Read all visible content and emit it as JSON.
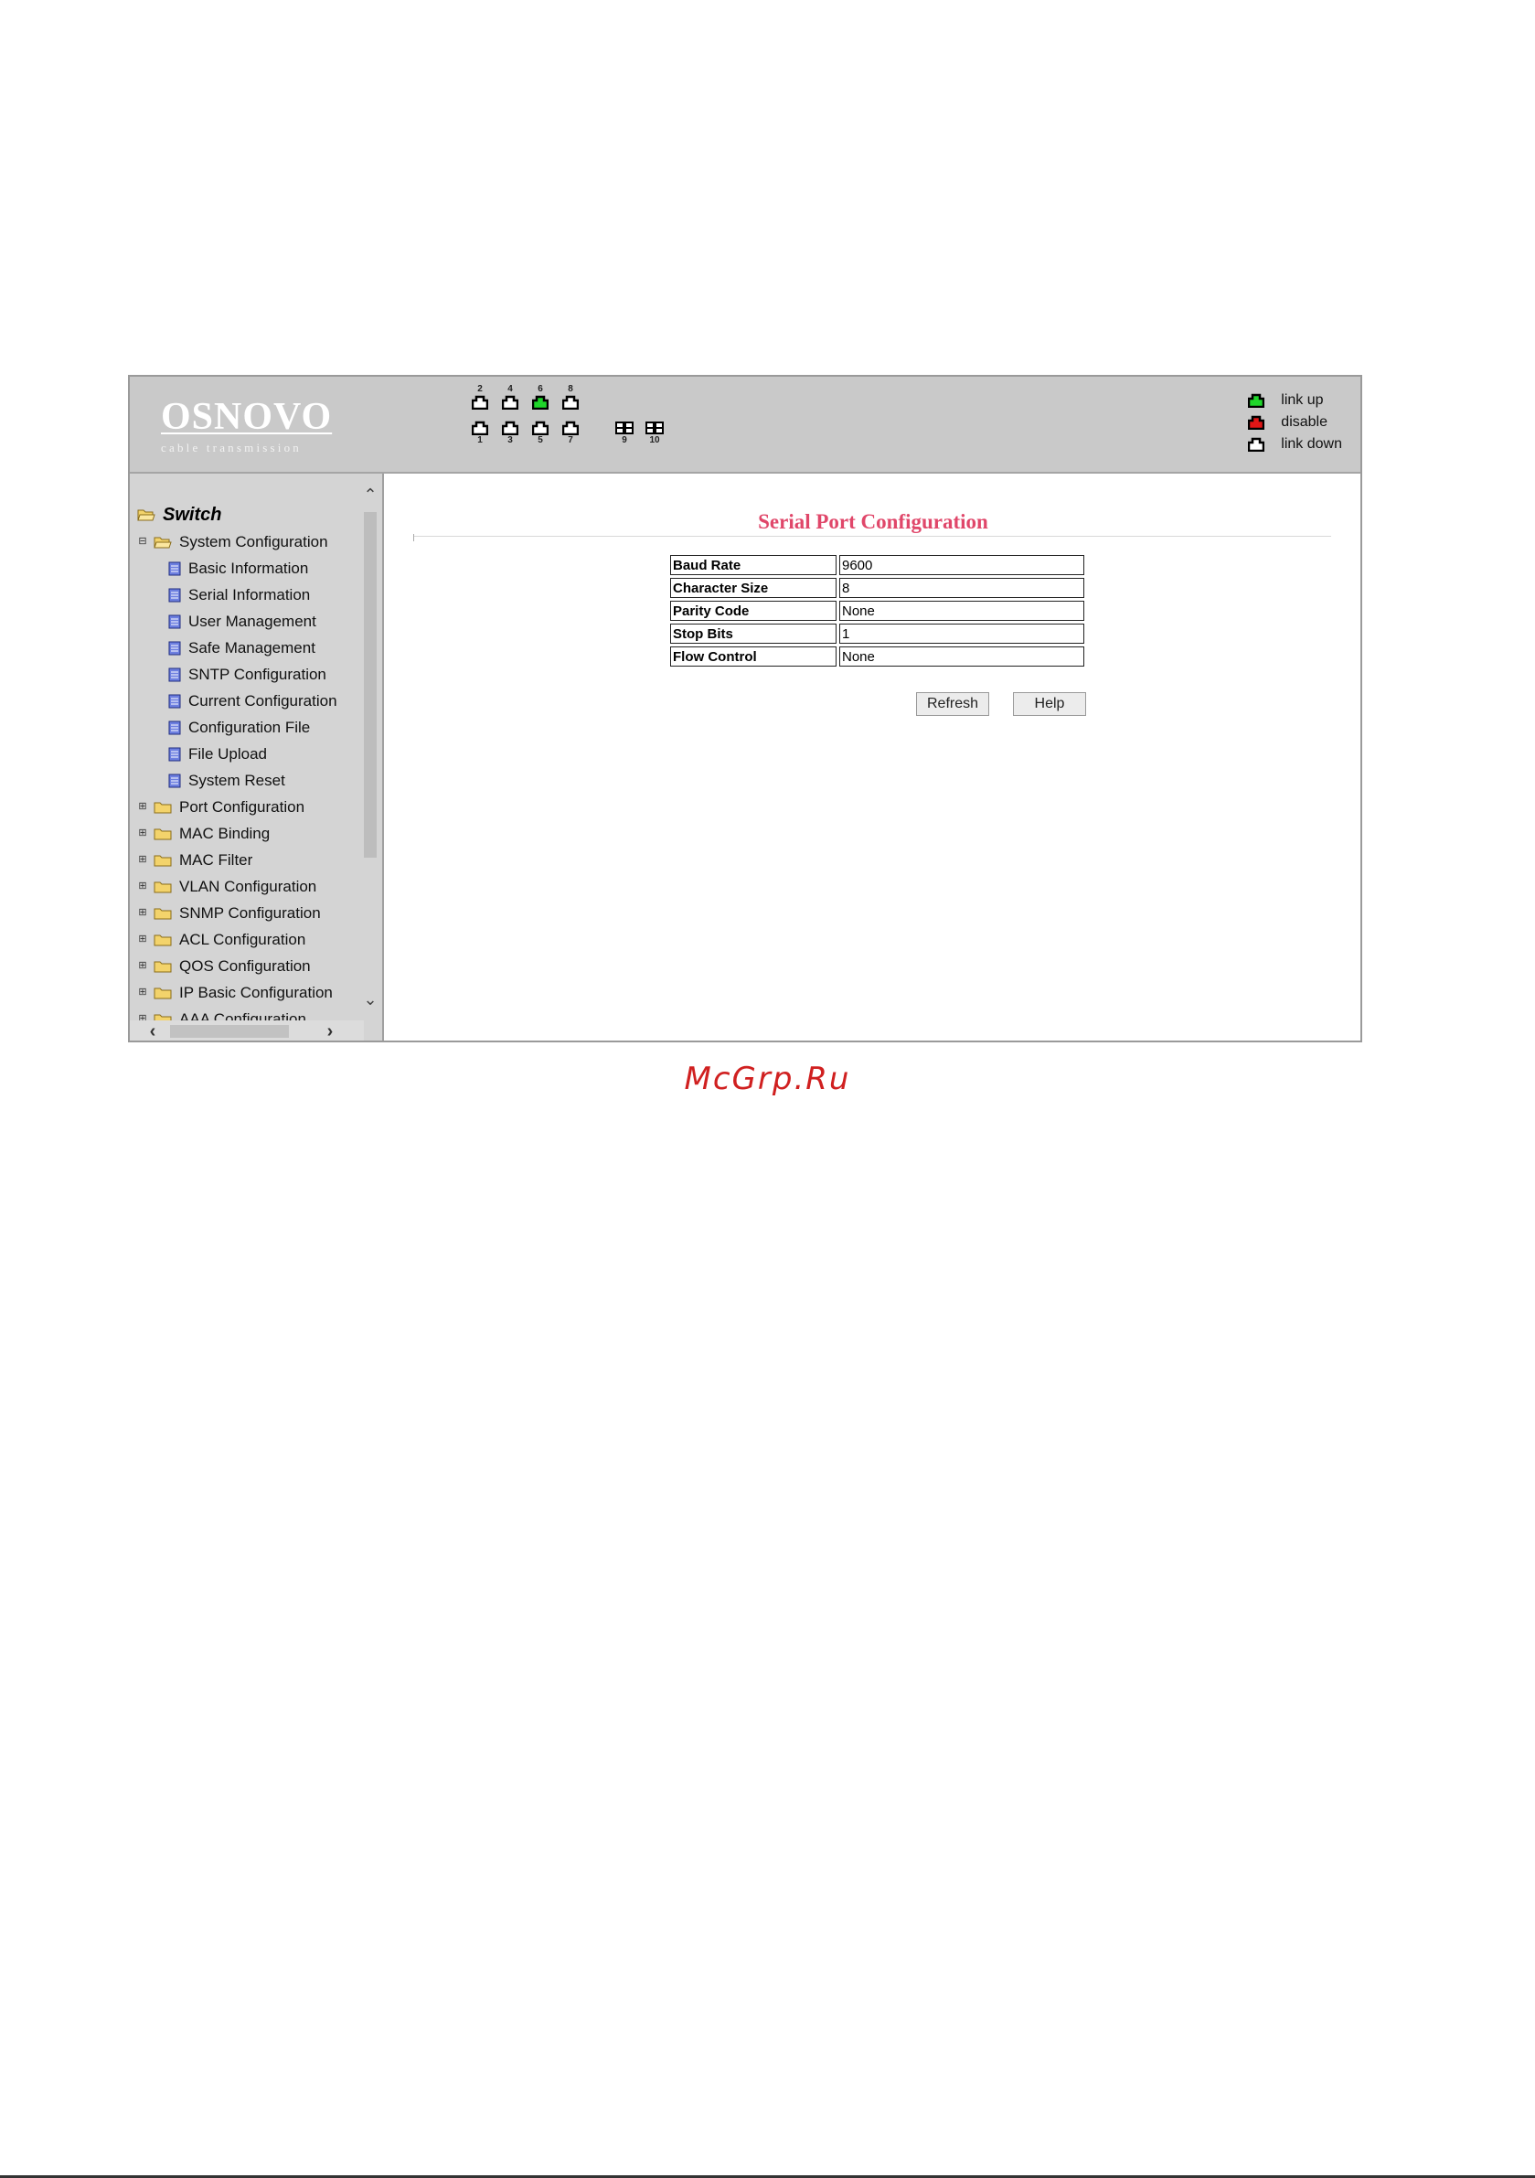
{
  "header": {
    "logo_name": "OSNOVO",
    "logo_sub": "cable transmission",
    "ports_top": [
      {
        "num": "2",
        "status": "down"
      },
      {
        "num": "4",
        "status": "down"
      },
      {
        "num": "6",
        "status": "up"
      },
      {
        "num": "8",
        "status": "down"
      }
    ],
    "ports_bottom": [
      {
        "num": "1",
        "status": "down"
      },
      {
        "num": "3",
        "status": "down"
      },
      {
        "num": "5",
        "status": "down"
      },
      {
        "num": "7",
        "status": "down"
      }
    ],
    "ports_sfp": [
      {
        "num": "9",
        "status": "down"
      },
      {
        "num": "10",
        "status": "down"
      }
    ],
    "legend": [
      {
        "label": "link up",
        "color": "#1fd62a"
      },
      {
        "label": "disable",
        "color": "#e01616"
      },
      {
        "label": "link down",
        "color": "#ffffff"
      }
    ]
  },
  "sidebar": {
    "root": "Switch",
    "items": [
      {
        "label": "System Configuration",
        "expanded": true,
        "children": [
          "Basic Information",
          "Serial Information",
          "User Management",
          "Safe Management",
          "SNTP Configuration",
          "Current Configuration",
          "Configuration File",
          "File Upload",
          "System Reset"
        ]
      },
      {
        "label": "Port Configuration",
        "expanded": false
      },
      {
        "label": "MAC Binding",
        "expanded": false
      },
      {
        "label": "MAC Filter",
        "expanded": false
      },
      {
        "label": "VLAN Configuration",
        "expanded": false
      },
      {
        "label": "SNMP Configuration",
        "expanded": false
      },
      {
        "label": "ACL Configuration",
        "expanded": false
      },
      {
        "label": "QOS Configuration",
        "expanded": false
      },
      {
        "label": "IP Basic Configuration",
        "expanded": false
      },
      {
        "label": "AAA Configuration",
        "expanded": false
      }
    ]
  },
  "main": {
    "title": "Serial Port Configuration",
    "rows": [
      {
        "key": "Baud Rate",
        "value": "9600"
      },
      {
        "key": "Character Size",
        "value": "8"
      },
      {
        "key": "Parity Code",
        "value": "None"
      },
      {
        "key": "Stop Bits",
        "value": "1"
      },
      {
        "key": "Flow Control",
        "value": "None"
      }
    ],
    "refresh_label": "Refresh",
    "help_label": "Help"
  },
  "watermark": "McGrp.Ru",
  "colors": {
    "title": "#e0476a",
    "header_bg": "#c9c9c9",
    "sidebar_bg": "#d4d4d4",
    "watermark": "#d02020"
  }
}
